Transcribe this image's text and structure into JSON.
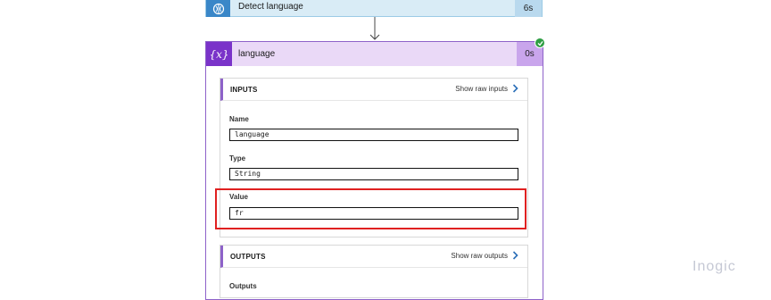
{
  "top_action": {
    "title": "Detect language",
    "duration": "6s"
  },
  "action": {
    "title": "language",
    "duration": "0s",
    "icon_text": "{x}"
  },
  "inputs": {
    "heading": "INPUTS",
    "raw_link": "Show raw inputs",
    "fields": [
      {
        "label": "Name",
        "value": "language"
      },
      {
        "label": "Type",
        "value": "String"
      },
      {
        "label": "Value",
        "value": "fr"
      }
    ]
  },
  "outputs": {
    "heading": "OUTPUTS",
    "raw_link": "Show raw outputs",
    "first_label": "Outputs"
  },
  "watermark": "Inogic",
  "colors": {
    "accent_purple": "#7a33c9",
    "header_lavender": "#ead9f7",
    "top_blue": "#d9ecf6",
    "success_green": "#2f9e44",
    "highlight_red": "#e02020",
    "link_blue": "#2b6fb8"
  }
}
